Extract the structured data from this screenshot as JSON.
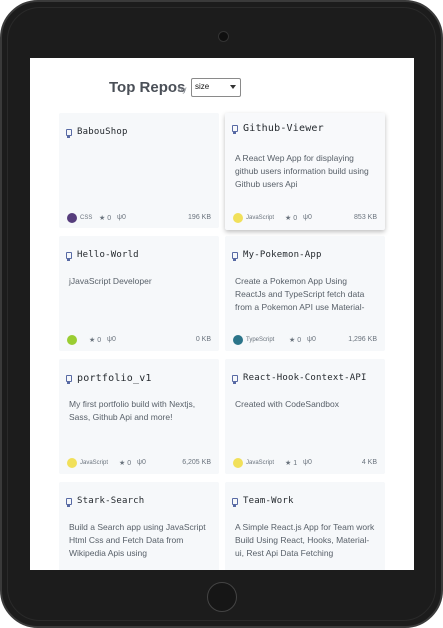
{
  "header": {
    "title": "Top Repos",
    "by_label": "by",
    "sort_value": "size"
  },
  "repos": [
    {
      "name": "BabouShop",
      "description": "",
      "language": "CSS",
      "lang_color": "#563d7c",
      "stars": "0",
      "forks": "0",
      "size": "196 KB"
    },
    {
      "name": "Github-Viewer",
      "description": "A React Wep App for displaying github users information build using Github users Api",
      "language": "JavaScript",
      "lang_color": "#f1e05a",
      "stars": "0",
      "forks": "0",
      "size": "853 KB"
    },
    {
      "name": "Hello-World",
      "description": "jJavaScript Developer",
      "language": "",
      "lang_color": "#9acd32",
      "stars": "0",
      "forks": "0",
      "size": "0 KB"
    },
    {
      "name": "My-Pokemon-App",
      "description": "Create a Pokemon App Using ReactJs and TypeScript fetch data from a Pokemon API use Material-",
      "language": "TypeScript",
      "lang_color": "#2b7489",
      "stars": "0",
      "forks": "0",
      "size": "1,296 KB"
    },
    {
      "name": "portfolio_v1",
      "description": "My first portfolio build with Nextjs, Sass, Github Api and more!",
      "language": "JavaScript",
      "lang_color": "#f1e05a",
      "stars": "0",
      "forks": "0",
      "size": "6,205 KB"
    },
    {
      "name": "React-Hook-Context-API",
      "description": "Created with CodeSandbox",
      "language": "JavaScript",
      "lang_color": "#f1e05a",
      "stars": "1",
      "forks": "0",
      "size": "4 KB"
    },
    {
      "name": "Stark-Search",
      "description": "Build a Search app using JavaScript Html Css and Fetch Data from Wikipedia Apis using",
      "language": "",
      "lang_color": "",
      "stars": "",
      "forks": "",
      "size": ""
    },
    {
      "name": "Team-Work",
      "description": "A Simple React.js App for Team work Build Using React, Hooks, Material-ui, Rest Api Data Fetching",
      "language": "",
      "lang_color": "",
      "stars": "",
      "forks": "",
      "size": ""
    }
  ],
  "icons": {
    "repo": "repo-icon",
    "star": "star-icon",
    "fork": "fork-icon",
    "camera": "camera",
    "home": "home-button"
  }
}
